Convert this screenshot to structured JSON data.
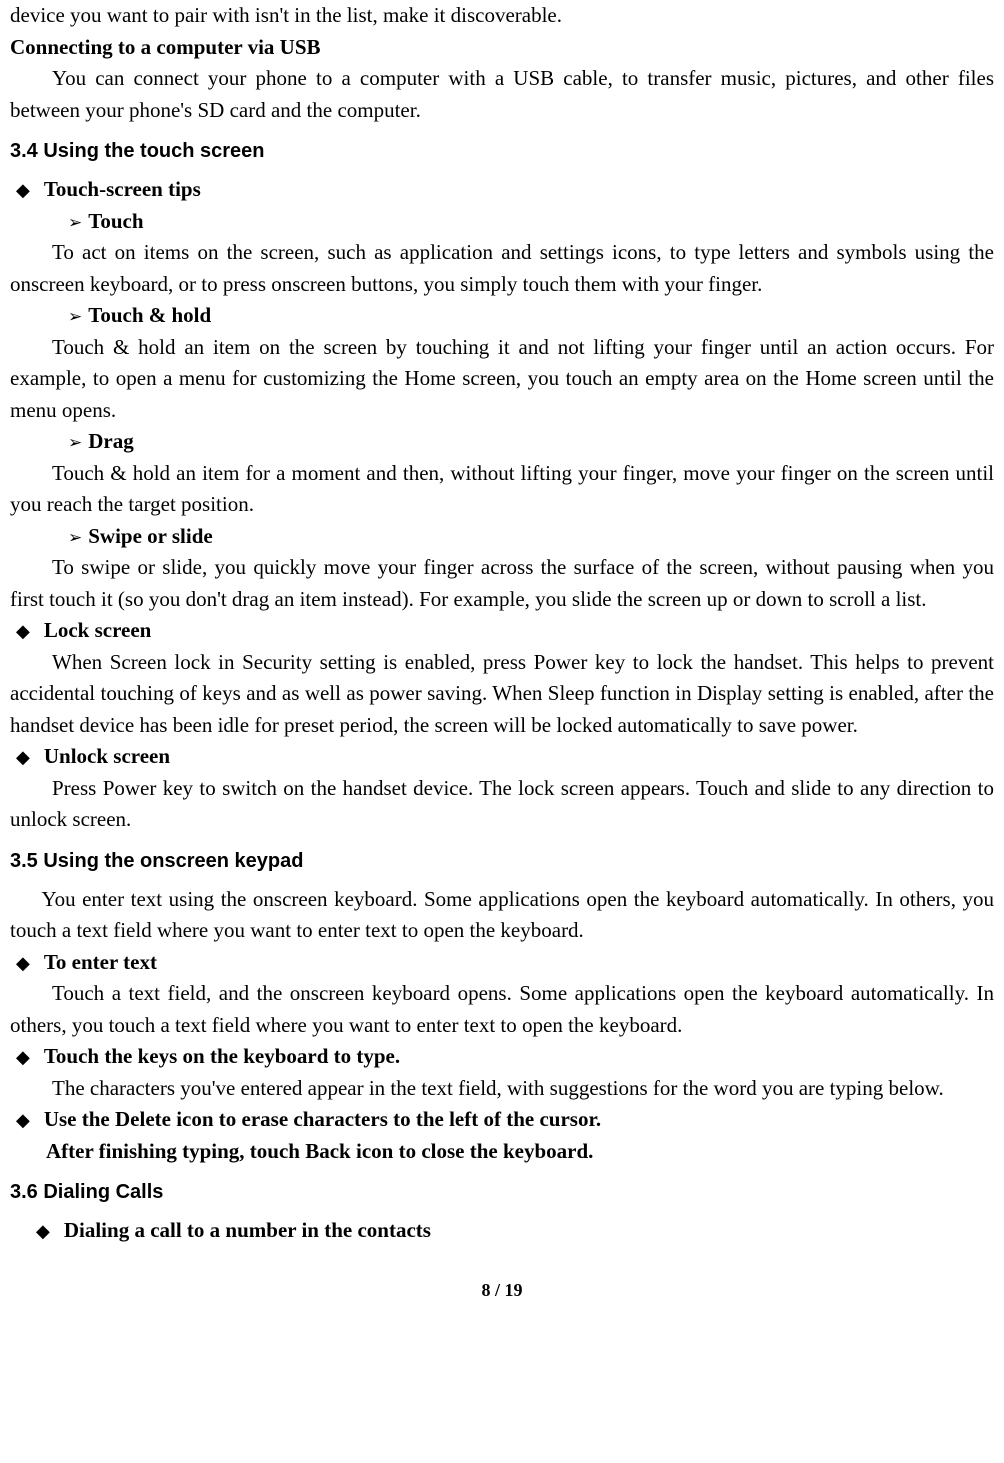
{
  "top": {
    "line1": "device you want to pair with isn't in the list, make it discoverable.",
    "usb_heading": "Connecting to a computer via USB",
    "usb_body": "You can connect your phone to a computer with a USB cable, to transfer music, pictures, and other files between your phone's SD card and the computer."
  },
  "s34": {
    "heading": "3.4    Using the touch screen",
    "tips": "Touch-screen tips",
    "touch_label": "Touch",
    "touch_body": "To act on items on the screen, such as application and settings icons, to type letters and symbols using the onscreen keyboard, or to press onscreen buttons, you simply touch them with your finger.",
    "hold_label": "Touch & hold",
    "hold_body": "Touch & hold an item on the screen by touching it and not lifting your finger until an action occurs. For example, to open a menu for customizing the Home screen, you touch an empty area on the Home screen until the menu opens.",
    "drag_label": "Drag",
    "drag_body": "Touch & hold an item for a moment and then, without lifting your finger, move your finger on the screen until you reach the target position.",
    "swipe_label": "Swipe or slide",
    "swipe_body": "To swipe or slide, you quickly move your finger across the surface of the screen, without pausing when you first touch it (so you don't drag an item instead). For example, you slide the screen up or down to scroll a list.",
    "lock_label": "Lock screen",
    "lock_body": "When Screen lock in Security setting is enabled, press Power key to lock the handset. This helps to prevent accidental touching of keys and as well as power saving. When Sleep function in Display setting is enabled, after the handset device has been idle for preset period, the screen will be locked automatically to save power.",
    "unlock_label": "Unlock screen",
    "unlock_body": "Press Power key to switch on the handset device. The lock screen appears. Touch and slide to any direction to unlock screen."
  },
  "s35": {
    "heading": "3.5    Using the onscreen keypad",
    "intro": "You enter text using the onscreen keyboard. Some applications open the keyboard automatically. In others, you touch a text field where you want to enter text to open the keyboard.",
    "enter_label": "To enter text",
    "enter_body": "Touch a text field, and the onscreen keyboard opens. Some applications open the keyboard automatically. In others, you touch a text field where you want to enter text to open the keyboard.",
    "type_label": "Touch the keys on the keyboard to type.",
    "type_body": "The characters you've entered appear in the text field, with suggestions for the word you are typing below.",
    "delete_label": "Use the Delete icon to erase characters to the left of the cursor.",
    "after_label": "After finishing typing, touch Back icon to close the keyboard."
  },
  "s36": {
    "heading": "3.6    Dialing Calls",
    "dial_label": "Dialing a call to a number in the contacts"
  },
  "footer": {
    "page": "8",
    "sep": " / ",
    "total": "19"
  }
}
